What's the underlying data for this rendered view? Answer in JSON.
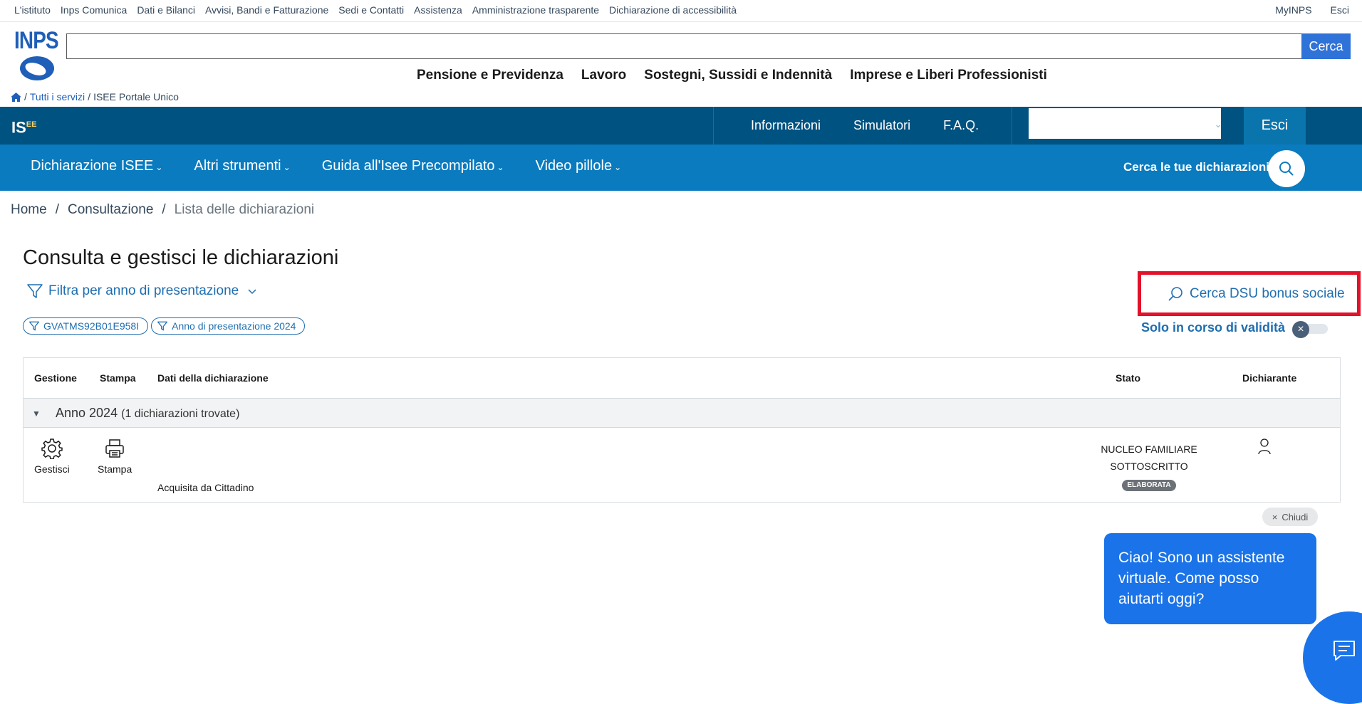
{
  "topbar": {
    "links": [
      "L'istituto",
      "Inps Comunica",
      "Dati e Bilanci",
      "Avvisi, Bandi e Fatturazione",
      "Sedi e Contatti",
      "Assistenza",
      "Amministrazione trasparente",
      "Dichiarazione di accessibilità"
    ],
    "myinps": "MyINPS",
    "esci": "Esci"
  },
  "header": {
    "logo_text": "INPS",
    "search_placeholder": "",
    "search_button": "Cerca",
    "nav": [
      "Pensione e Previdenza",
      "Lavoro",
      "Sostegni, Sussidi e Indennità",
      "Imprese e Liberi Professionisti"
    ]
  },
  "breadcrumb_top": {
    "sep": "/",
    "items": [
      "Tutti i servizi",
      "ISEE Portale Unico"
    ]
  },
  "isee_bar": {
    "logo": "IS",
    "logo_sup": "EE",
    "nav": [
      "Informazioni",
      "Simulatori",
      "F.A.Q."
    ],
    "esci": "Esci"
  },
  "subnav": {
    "items": [
      "Dichiarazione ISEE",
      "Altri strumenti",
      "Guida all'Isee Precompilato",
      "Video pillole"
    ],
    "cerca_label": "Cerca le tue dichiarazioni"
  },
  "breadcrumb": {
    "home": "Home",
    "sep": "/",
    "consultazione": "Consultazione",
    "current": "Lista delle dichiarazioni"
  },
  "page": {
    "title": "Consulta e gestisci le dichiarazioni",
    "filter_label": "Filtra per anno di presentazione",
    "chips": [
      "GVATMS92B01E958I",
      "Anno di presentazione 2024"
    ],
    "dsu_button": "Cerca DSU bonus sociale",
    "solo_validita": "Solo in corso di validità",
    "toggle_on": false
  },
  "table": {
    "headers": {
      "gestione": "Gestione",
      "stampa": "Stampa",
      "dati": "Dati della dichiarazione",
      "stato": "Stato",
      "dichiarante": "Dichiarante"
    },
    "group": {
      "label": "Anno 2024",
      "count": "(1 dichiarazioni trovate)"
    },
    "row": {
      "gestisci": "Gestisci",
      "stampa": "Stampa",
      "acquisita": "Acquisita da Cittadino",
      "stato_line1": "NUCLEO FAMILIARE",
      "stato_line2": "SOTTOSCRITTO",
      "badge": "ELABORATA"
    }
  },
  "chat": {
    "close": "Chiudi",
    "message": "Ciao! Sono un assistente virtuale. Come posso aiutarti oggi?"
  },
  "colors": {
    "isee_dark": "#005280",
    "subnav_blue": "#0a7bbf",
    "link_blue": "#1f6eb0",
    "highlight_red": "#e3122b",
    "chat_blue": "#1a73e8"
  }
}
